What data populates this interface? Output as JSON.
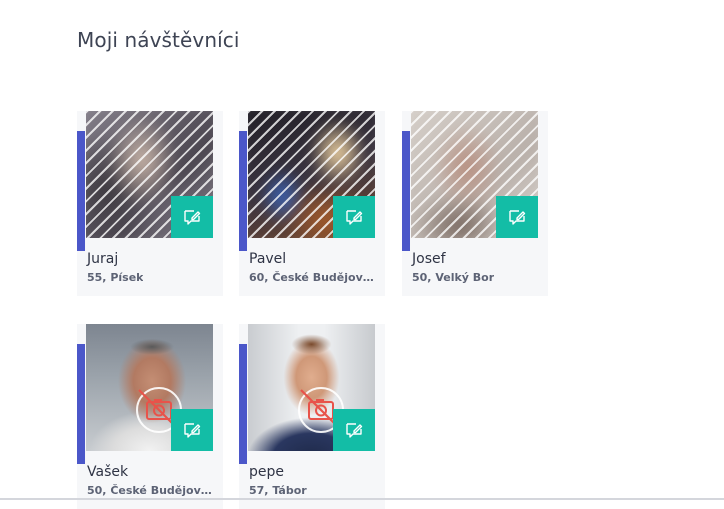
{
  "page": {
    "title": "Moji návštěvníci"
  },
  "icons": {
    "message": "message-edit-icon",
    "no_photo": "camera-crossed-icon"
  },
  "colors": {
    "accent": "#4b57c9",
    "action": "#13bda6",
    "card_bg": "#f6f7f9"
  },
  "visitors": [
    {
      "name": "Juraj",
      "info": "55, Písek",
      "photo": "blurred"
    },
    {
      "name": "Pavel",
      "info": "60, České Budějovic...",
      "photo": "blurred"
    },
    {
      "name": "Josef",
      "info": "50, Velký Bor",
      "photo": "blurred"
    },
    {
      "name": "Vašek",
      "info": "50, České Budějovic...",
      "photo": "not-approved"
    },
    {
      "name": "pepe",
      "info": "57, Tábor",
      "photo": "not-approved"
    }
  ]
}
